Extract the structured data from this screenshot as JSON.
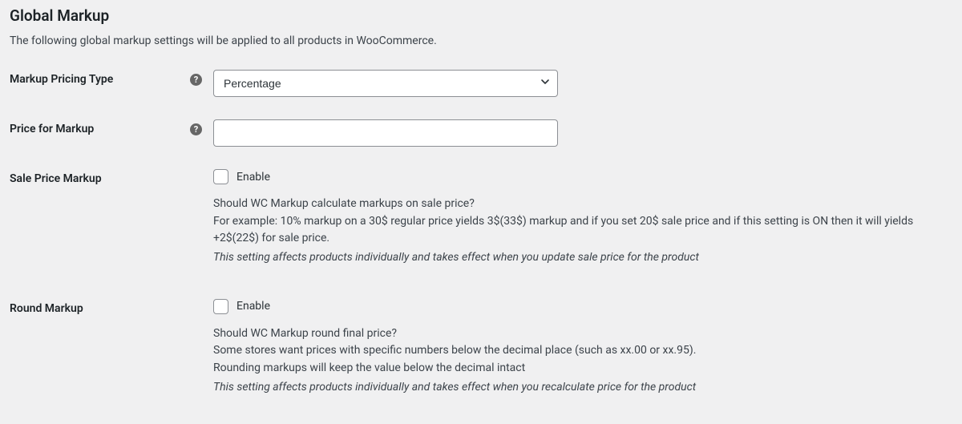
{
  "section": {
    "title": "Global Markup",
    "description": "The following global markup settings will be applied to all products in WooCommerce."
  },
  "fields": {
    "markup_pricing_type": {
      "label": "Markup Pricing Type",
      "selected": "Percentage"
    },
    "price_for_markup": {
      "label": "Price for Markup",
      "value": ""
    },
    "sale_price_markup": {
      "label": "Sale Price Markup",
      "checkbox_label": "Enable",
      "help_q": "Should WC Markup calculate markups on sale price?",
      "help_example": "For example: 10% markup on a 30$ regular price yields 3$(33$) markup and if you set 20$ sale price and if this setting is ON then it will yields +2$(22$) for sale price.",
      "help_note": "This setting affects products individually and takes effect when you update sale price for the product"
    },
    "round_markup": {
      "label": "Round Markup",
      "checkbox_label": "Enable",
      "help_q": "Should WC Markup round final price?",
      "help_line1": "Some stores want prices with specific numbers below the decimal place (such as xx.00 or xx.95).",
      "help_line2": "Rounding markups will keep the value below the decimal intact",
      "help_note": "This setting affects products individually and takes effect when you recalculate price for the product"
    }
  }
}
